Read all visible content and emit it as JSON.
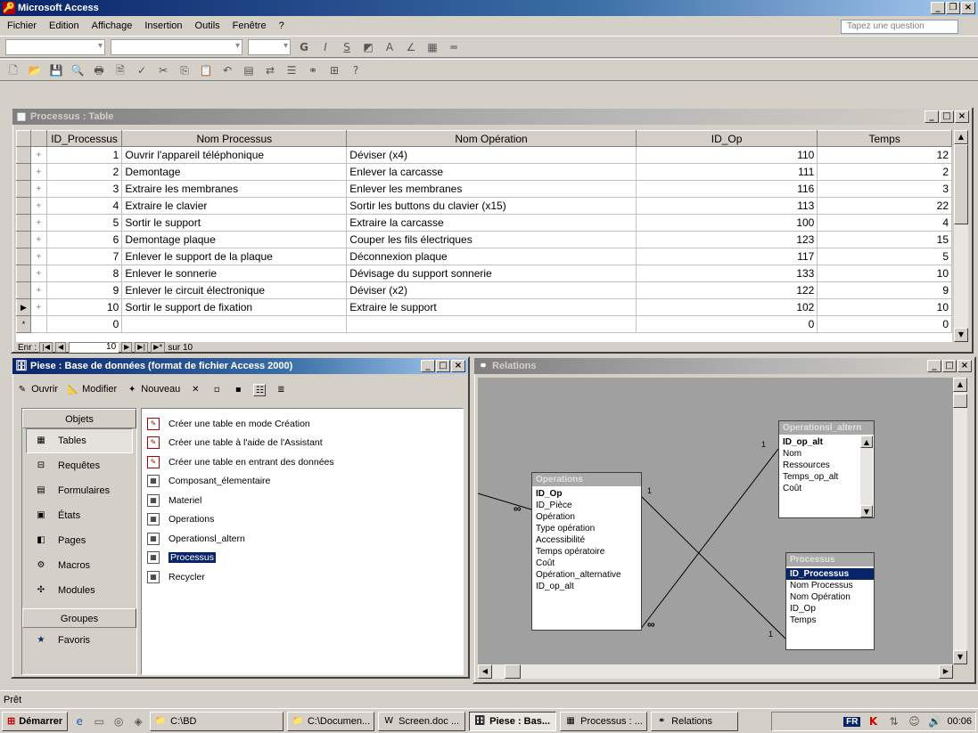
{
  "app": {
    "title": "Microsoft Access",
    "menu": [
      "Fichier",
      "Edition",
      "Affichage",
      "Insertion",
      "Outils",
      "Fenêtre",
      "?"
    ],
    "ask_placeholder": "Tapez une question",
    "status": "Prêt"
  },
  "datasheet": {
    "title": "Processus : Table",
    "columns": [
      "ID_Processus",
      "Nom Processus",
      "Nom Opération",
      "ID_Op",
      "Temps"
    ],
    "rows": [
      [
        "1",
        "Ouvrir l'appareil téléphonique",
        "Déviser (x4)",
        "110",
        "12"
      ],
      [
        "2",
        "Demontage",
        "Enlever la carcasse",
        "111",
        "2"
      ],
      [
        "3",
        "Extraire les membranes",
        "Enlever les membranes",
        "116",
        "3"
      ],
      [
        "4",
        "Extraire le clavier",
        "Sortir les buttons du clavier (x15)",
        "113",
        "22"
      ],
      [
        "5",
        "Sortir le support",
        "Extraire la carcasse",
        "100",
        "4"
      ],
      [
        "6",
        "Demontage plaque",
        "Couper les fils électriques",
        "123",
        "15"
      ],
      [
        "7",
        "Enlever le support de la plaque",
        "Déconnexion plaque",
        "117",
        "5"
      ],
      [
        "8",
        "Enlever le sonnerie",
        "Dévisage du support sonnerie",
        "133",
        "10"
      ],
      [
        "9",
        "Enlever le circuit électronique",
        "Déviser (x2)",
        "122",
        "9"
      ],
      [
        "10",
        "Sortir le support de fixation",
        "Extraire le support",
        "102",
        "10"
      ]
    ],
    "new_row": [
      "0",
      "",
      "",
      "0",
      "0"
    ],
    "nav": {
      "label": "Enr :",
      "current": "10",
      "of": "sur 10"
    }
  },
  "dbwindow": {
    "title": "Piese : Base de données (format de fichier Access 2000)",
    "toolbar": {
      "open": "Ouvrir",
      "modify": "Modifier",
      "new": "Nouveau"
    },
    "objects_header": "Objets",
    "objects": [
      {
        "label": "Tables",
        "icon": "table-icon",
        "selected": true
      },
      {
        "label": "Requêtes",
        "icon": "query-icon"
      },
      {
        "label": "Formulaires",
        "icon": "form-icon"
      },
      {
        "label": "États",
        "icon": "report-icon"
      },
      {
        "label": "Pages",
        "icon": "page-icon"
      },
      {
        "label": "Macros",
        "icon": "macro-icon"
      },
      {
        "label": "Modules",
        "icon": "module-icon"
      }
    ],
    "groups_header": "Groupes",
    "favorites": "Favoris",
    "items": [
      "Créer une table en mode Création",
      "Créer une table à l'aide de l'Assistant",
      "Créer une table en entrant des données",
      "Composant_élementaire",
      "Materiel",
      "Operations",
      "Operationsl_altern",
      "Processus",
      "Recycler"
    ],
    "selected_item": "Processus"
  },
  "relations": {
    "title": "Relations",
    "tables": {
      "operations": {
        "name": "Operations",
        "fields": [
          "ID_Op",
          "ID_Pièce",
          "Opération",
          "Type opération",
          "Accessibilité",
          "Temps opératoire",
          "Coût",
          "Opération_alternative",
          "ID_op_alt"
        ]
      },
      "alt": {
        "name": "Operationsl_altern",
        "fields": [
          "ID_op_alt",
          "Nom",
          "Ressources",
          "Temps_op_alt",
          "Coût"
        ]
      },
      "processus": {
        "name": "Processus",
        "fields": [
          "ID_Processus",
          "Nom Processus",
          "Nom Opération",
          "ID_Op",
          "Temps"
        ]
      }
    },
    "one": "1",
    "many": "∞"
  },
  "taskbar": {
    "start": "Démarrer",
    "tasks": [
      "C:\\BD",
      "C:\\Documen...",
      "Screen.doc ...",
      "Piese : Bas...",
      "Processus : ...",
      "Relations"
    ],
    "lang": "FR",
    "clock": "00:06"
  }
}
